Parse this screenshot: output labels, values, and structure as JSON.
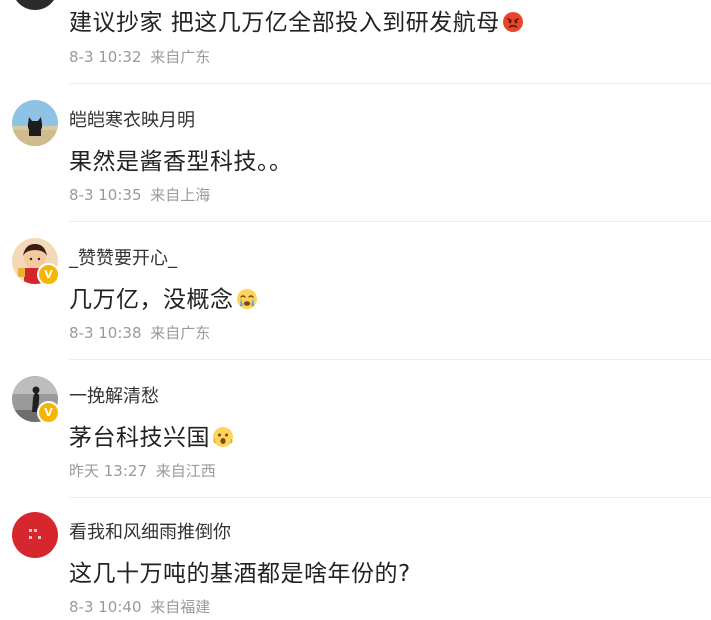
{
  "comments": [
    {
      "username": "",
      "content": "建议抄家 把这几万亿全部投入到研发航母",
      "emoji": "angry-face-emoji",
      "date": "8-3 10:32",
      "location": "来自广东"
    },
    {
      "username": "皑皑寒衣映月明",
      "content": "果然是酱香型科技。。",
      "date": "8-3 10:35",
      "location": "来自上海"
    },
    {
      "username": "_赞赞要开心_",
      "content": "几万亿，没概念",
      "emoji": "crying-face-emoji",
      "verified": true,
      "date": "8-3 10:38",
      "location": "来自广东"
    },
    {
      "username": "一挽解清愁",
      "content": "茅台科技兴国",
      "emoji": "shocked-face-emoji",
      "verified": true,
      "date": "昨天 13:27",
      "location": "来自江西"
    },
    {
      "username": "看我和风细雨推倒你",
      "content": "这几十万吨的基酒都是啥年份的?",
      "date": "8-3 10:40",
      "location": "来自福建"
    }
  ],
  "colors": {
    "text_primary": "#222222",
    "text_meta": "#9a9a9a",
    "divider": "#eeeeee",
    "verified_badge": "#f7b500"
  }
}
